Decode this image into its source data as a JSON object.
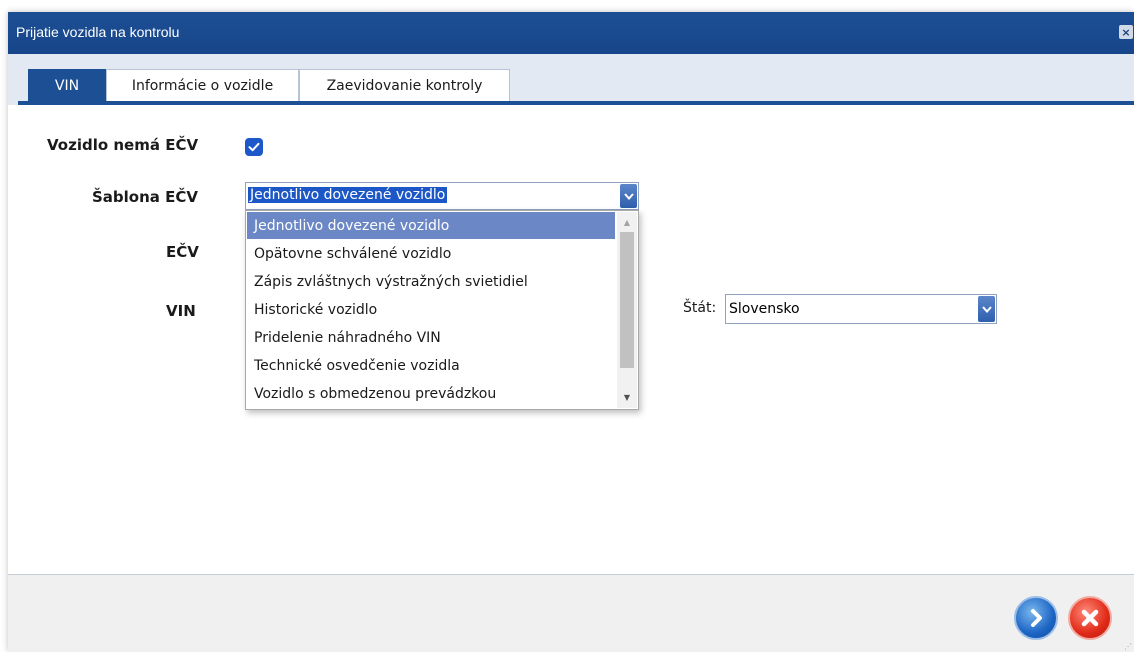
{
  "window": {
    "title": "Prijatie vozidla na kontrolu",
    "close_label": "×"
  },
  "tabs": [
    {
      "label": "VIN",
      "active": true
    },
    {
      "label": "Informácie o vozidle",
      "active": false
    },
    {
      "label": "Zaevidovanie kontroly",
      "active": false
    }
  ],
  "form": {
    "no_plate_label": "Vozidlo nemá EČV",
    "no_plate_checked": true,
    "template_label": "Šablona EČV",
    "template_value": "Jednotlivo dovezené vozidlo",
    "ecv_label": "EČV",
    "vin_label": "VIN",
    "state_label": "Štát:",
    "state_value": "Slovensko"
  },
  "dropdown": {
    "options": [
      "Jednotlivo dovezené vozidlo",
      "Opätovne schválené vozidlo",
      "Zápis zvláštnych výstražných svietidiel",
      "Historické vozidlo",
      "Pridelenie náhradného VIN",
      "Technické osvedčenie vozidla",
      "Vozidlo s obmedzenou prevádzkou"
    ],
    "selected_index": 0
  },
  "footer": {
    "next_button": "next-arrow",
    "cancel_button": "cancel-x"
  },
  "colors": {
    "titlebar": "#1d4f94",
    "tab_active": "#1d4f94",
    "selection": "#6b87c6",
    "checkbox": "#1c58c9",
    "next_button": "#1d65c4",
    "cancel_button": "#e12a18"
  }
}
